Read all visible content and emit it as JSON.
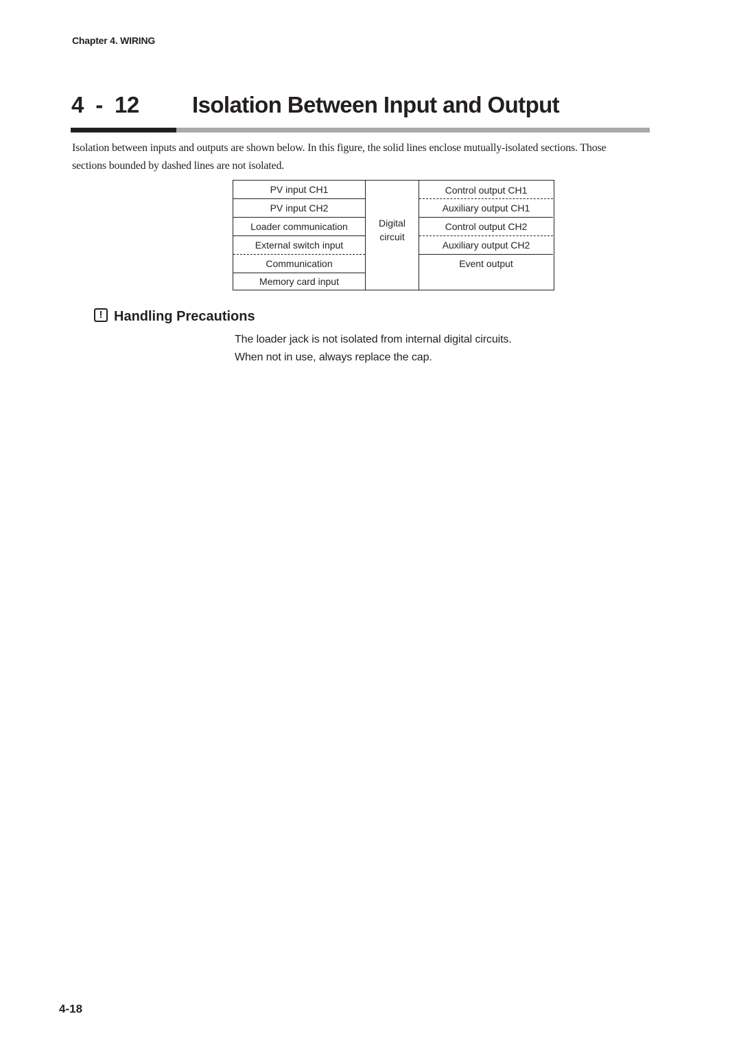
{
  "header": {
    "chapter": "Chapter 4. WIRING"
  },
  "section": {
    "number_major": "4",
    "number_sep": "-",
    "number_minor": "12",
    "title": "Isolation Between Input and Output",
    "rule_colors": {
      "dark": "#231f20",
      "light": "#a7a9ac"
    }
  },
  "intro": "Isolation between inputs and outputs are shown below. In this figure, the solid lines enclose mutually-isolated sections. Those sections bounded by dashed lines are not isolated.",
  "diagram": {
    "inputs": [
      {
        "label": "PV input CH1"
      },
      {
        "label": "PV input CH2"
      },
      {
        "label": "Loader communication"
      },
      {
        "label": "External switch input"
      },
      {
        "label": "Communication"
      },
      {
        "label": "Memory card input"
      }
    ],
    "digital_circuit": {
      "line1": "Digital",
      "line2": "circuit"
    },
    "outputs": [
      {
        "label": "Control output CH1"
      },
      {
        "label": "Auxiliary output CH1"
      },
      {
        "label": "Control output CH2"
      },
      {
        "label": "Auxiliary output CH2"
      },
      {
        "label": "Event output"
      }
    ],
    "legend": {
      "solid": "mutually-isolated",
      "dashed": "not isolated"
    }
  },
  "precautions": {
    "icon": "warning-exclamation-icon",
    "heading": "Handling Precautions",
    "lines": [
      "The loader jack is not isolated from internal digital circuits.",
      "When not in use, always replace the cap."
    ]
  },
  "footer": {
    "page_number": "4-18"
  }
}
